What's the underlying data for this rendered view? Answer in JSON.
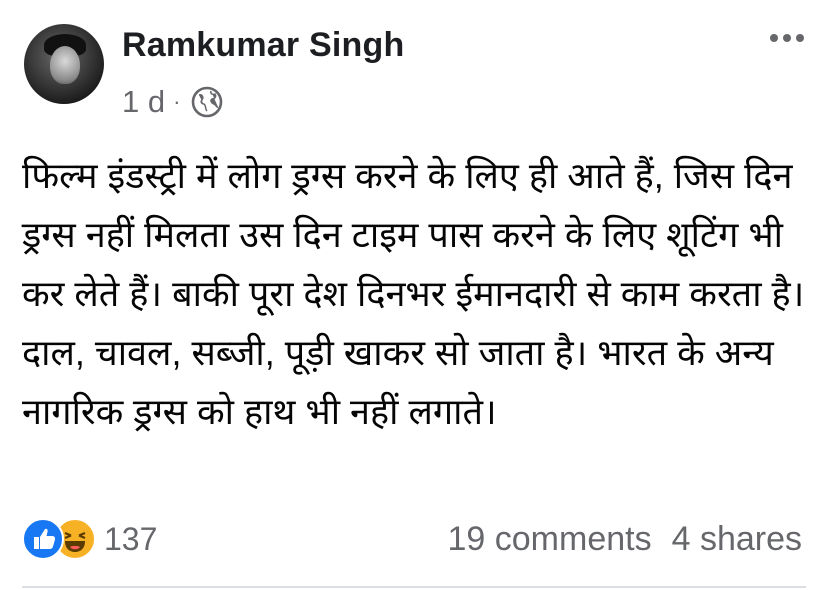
{
  "post": {
    "author": "Ramkumar Singh",
    "time": "1 d",
    "separator": "·",
    "privacy_icon": "globe-icon",
    "more_icon": "more-options-icon",
    "text": "फिल्म इंडस्ट्री में लोग ड्रग्स करने के लिए ही आते हैं, जिस दिन ड्रग्स नहीं मिलता उस दिन टाइम पास करने के लिए शूटिंग भी कर लेते हैं। बाकी पूरा देश दिनभर ईमानदारी से काम करता है। दाल, चावल, सब्जी, पूड़ी खाकर सो जाता है। भारत के अन्य नागरिक ड्रग्स को हाथ भी नहीं लगाते।"
  },
  "reactions": {
    "icons": [
      "like-icon",
      "haha-icon"
    ],
    "count": "137",
    "colors": {
      "like": "#1877f2",
      "haha": "#f7b125"
    }
  },
  "stats": {
    "comments": "19 comments",
    "shares": "4 shares"
  },
  "colors": {
    "text": "#050505",
    "secondary": "#65676b",
    "divider": "#dadde1"
  }
}
